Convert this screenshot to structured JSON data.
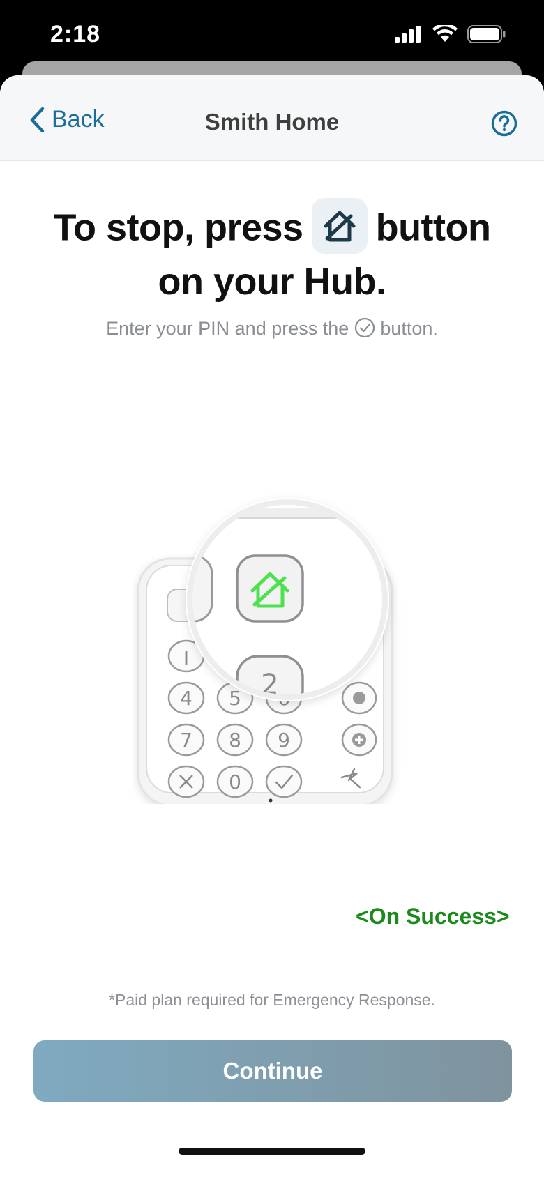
{
  "status_bar": {
    "time": "2:18"
  },
  "nav": {
    "back_label": "Back",
    "title": "Smith Home"
  },
  "headline": {
    "part1": "To stop, press",
    "part2": "button",
    "line2": "on your Hub."
  },
  "subtitle": {
    "before": "Enter your PIN and press the",
    "after": "button."
  },
  "keypad": {
    "keys": [
      "4",
      "5",
      "6",
      "7",
      "8",
      "9",
      "0"
    ],
    "top_partial_key": "I",
    "partial_number_key": "2"
  },
  "footnote": "*Paid plan required for Emergency Response.",
  "overlay_annotation": "<On Success>",
  "continue_button": {
    "label": "Continue"
  },
  "colors": {
    "accent": "#1c6c98",
    "success_green": "#1a8a1a",
    "hub_button_green": "#4ee04e"
  },
  "icons": {
    "back": "chevron-left-icon",
    "help": "question-circle-icon",
    "home_stop": "home-disarm-icon",
    "check": "check-circle-icon"
  }
}
